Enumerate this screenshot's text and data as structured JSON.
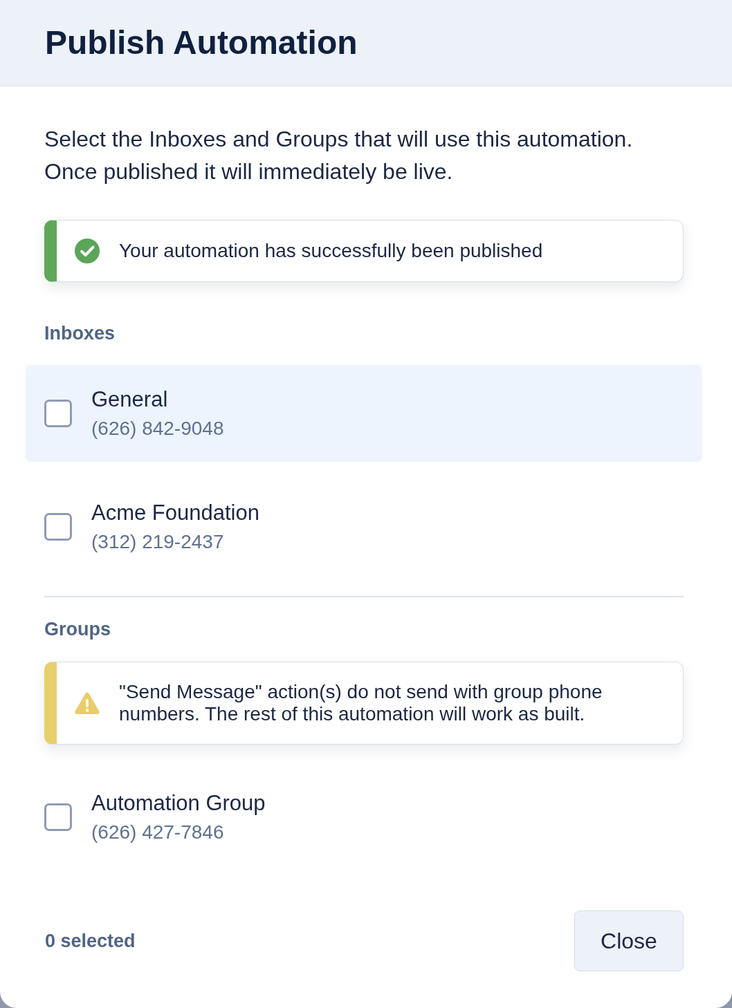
{
  "dialog": {
    "title": "Publish Automation"
  },
  "description": "Select the Inboxes and Groups that will use this automation. Once published it will immediately be live.",
  "notice": {
    "kind": "success",
    "text": "Your automation has successfully been published"
  },
  "sections": [
    {
      "heading": "Inboxes",
      "items": [
        {
          "name": "General",
          "phone": "(626) 842-9048",
          "checked": false,
          "hovered": true
        },
        {
          "name": "Acme Foundation",
          "phone": "(312) 219-2437",
          "checked": false,
          "hovered": false
        }
      ]
    },
    {
      "heading": "Groups",
      "notice": {
        "kind": "warning",
        "text": "\"Send Message\" action(s) do not send with group phone numbers. The rest of this automation will work as built."
      },
      "items": [
        {
          "name": "Automation Group",
          "phone": "(626) 427-7846",
          "checked": false,
          "hovered": false
        }
      ]
    }
  ],
  "footer": {
    "selected_count": "0 selected",
    "close_button": "Close"
  }
}
